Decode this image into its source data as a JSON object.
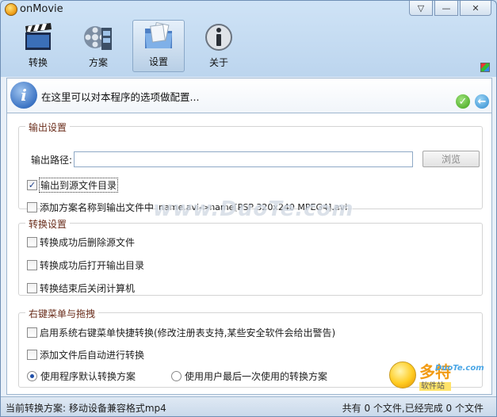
{
  "window": {
    "title": "onMovie"
  },
  "toolbar": {
    "items": [
      {
        "label": "转换",
        "icon": "film-clapper-icon"
      },
      {
        "label": "方案",
        "icon": "film-reel-icon"
      },
      {
        "label": "设置",
        "icon": "folder-settings-icon"
      },
      {
        "label": "关于",
        "icon": "info-icon"
      }
    ],
    "active_index": 2
  },
  "info": {
    "text": "在这里可以对本程序的选项做配置..."
  },
  "output_settings": {
    "title": "输出设置",
    "path_label": "输出路径:",
    "path_value": "",
    "browse_label": "浏览",
    "to_source_dir": {
      "label": "输出到源文件目录",
      "checked": true
    },
    "add_scheme_name": {
      "label": "添加方案名称到输出文件中",
      "checked": false
    },
    "example": "name.avi->name[PSP  320x240 MPEG4].avi"
  },
  "convert_settings": {
    "title": "转换设置",
    "options": [
      {
        "label": "转换成功后删除源文件",
        "checked": false
      },
      {
        "label": "转换成功后打开输出目录",
        "checked": false
      },
      {
        "label": "转换结束后关闭计算机",
        "checked": false
      }
    ]
  },
  "context_menu": {
    "title": "右键菜单与拖拽",
    "options": [
      {
        "label": "启用系统右键菜单快捷转换(修改注册表支持,某些安全软件会给出警告)",
        "checked": false
      },
      {
        "label": "添加文件后自动进行转换",
        "checked": false
      }
    ],
    "radio_default": {
      "label": "使用程序默认转换方案",
      "selected": true
    },
    "radio_last": {
      "label": "使用用户最后一次使用的转换方案",
      "selected": false
    }
  },
  "watermark": {
    "text": "www.DuoTe.com"
  },
  "logo": {
    "main": "多特",
    "sub": "软件站",
    "url": "DuoTe.com"
  },
  "status": {
    "left": "当前转换方案: 移动设备兼容格式mp4",
    "right": "共有 0 个文件,已经完成 0 个文件"
  },
  "colors": {
    "accent": "#3c74c4",
    "group_title": "#6a2d1b",
    "ok": "#3ea117"
  }
}
